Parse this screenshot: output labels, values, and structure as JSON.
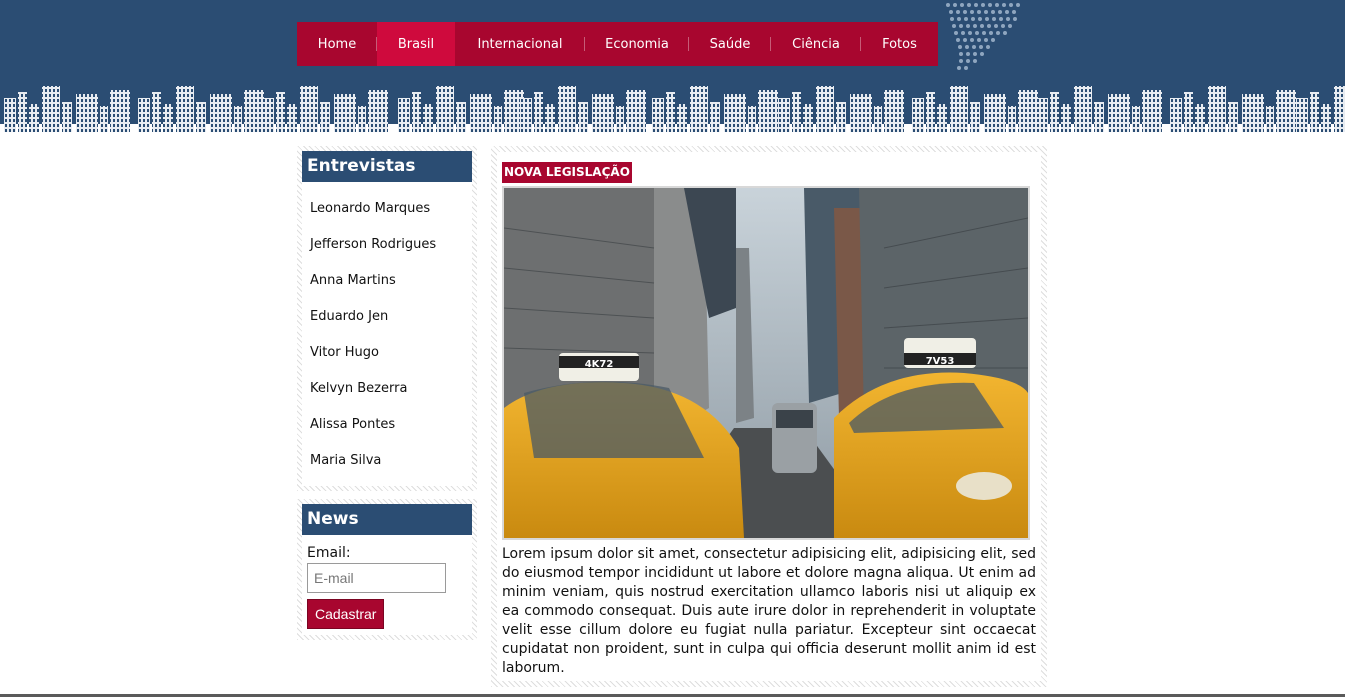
{
  "colors": {
    "header_bg": "#2b4d73",
    "nav_bg": "#a8062f",
    "nav_active_bg": "#cf0a3d",
    "accent": "#a8062f"
  },
  "nav": {
    "items": [
      {
        "label": "Home"
      },
      {
        "label": "Brasil",
        "active": true
      },
      {
        "label": "Internacional"
      },
      {
        "label": "Economia"
      },
      {
        "label": "Saúde"
      },
      {
        "label": "Ciência"
      },
      {
        "label": "Fotos"
      }
    ]
  },
  "interviews": {
    "title": "Entrevistas",
    "items": [
      "Leonardo Marques",
      "Jefferson Rodrigues",
      "Anna Martins",
      "Eduardo Jen",
      "Vitor Hugo",
      "Kelvyn Bezerra",
      "Alissa Pontes",
      "Maria Silva"
    ]
  },
  "news": {
    "title": "News",
    "email_label": "Email:",
    "email_placeholder": "E-mail",
    "email_value": "",
    "submit_label": "Cadastrar"
  },
  "article": {
    "tag": "NOVA LEGISLAÇÃO",
    "photo_plates": [
      "4K72",
      "7V53"
    ],
    "body": "Lorem ipsum dolor sit amet, consectetur adipisicing elit, adipisicing elit, sed do eiusmod tempor incididunt ut labore et dolore magna aliqua. Ut enim ad minim veniam, quis nostrud exercitation ullamco laboris nisi ut aliquip ex ea commodo consequat. Duis aute irure dolor in reprehenderit in voluptate velit esse cillum dolore eu fugiat nulla pariatur. Excepteur sint occaecat cupidatat non proident, sunt in culpa qui officia deserunt mollit anim id est laborum."
  }
}
